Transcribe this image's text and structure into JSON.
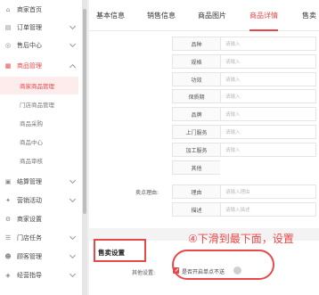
{
  "sidebar": {
    "items": [
      {
        "label": "商家首页",
        "icon": "home-icon"
      },
      {
        "label": "订单管理",
        "icon": "order-icon"
      },
      {
        "label": "售后中心",
        "icon": "aftersale-icon"
      },
      {
        "label": "商品管理",
        "icon": "product-icon"
      },
      {
        "label": "结算管理",
        "icon": "settlement-icon"
      },
      {
        "label": "营销活动",
        "icon": "marketing-icon"
      },
      {
        "label": "商家设置",
        "icon": "settings-icon"
      },
      {
        "label": "门店任务",
        "icon": "store-task-icon"
      },
      {
        "label": "顾客管理",
        "icon": "customer-icon"
      },
      {
        "label": "经营指导",
        "icon": "guide-icon"
      }
    ],
    "subitems": [
      {
        "label": "商家商品管理"
      },
      {
        "label": "门店商品管理"
      },
      {
        "label": "商品采购"
      },
      {
        "label": "商品中心"
      },
      {
        "label": "商品审核"
      }
    ]
  },
  "tabs": [
    {
      "label": "基本信息"
    },
    {
      "label": "销售信息"
    },
    {
      "label": "商品图片"
    },
    {
      "label": "商品详情"
    },
    {
      "label": "售卖"
    }
  ],
  "detail_rows": [
    {
      "label": "品种",
      "placeholder": "请输入"
    },
    {
      "label": "规格",
      "placeholder": "请输入"
    },
    {
      "label": "功效",
      "placeholder": "请输入"
    },
    {
      "label": "保质期",
      "placeholder": "请输入"
    },
    {
      "label": "品牌",
      "placeholder": "请输入"
    },
    {
      "label": "上门服务",
      "placeholder": "请输入"
    },
    {
      "label": "加工服务",
      "placeholder": "请输入"
    },
    {
      "label": "其他",
      "placeholder": ""
    }
  ],
  "buy_points": {
    "label": "卖点理由:",
    "rows": [
      {
        "label": "理由",
        "placeholder": "请输入理由"
      },
      {
        "label": "描述",
        "placeholder": "请输入描述"
      }
    ]
  },
  "sale_settings": {
    "title": "售卖设置",
    "row_label": "其他设置:",
    "checkbox_label": "是否开启单点不送",
    "checked": true
  },
  "annotation": {
    "text": "④下滑到最下面，设置",
    "color": "#e84848"
  },
  "colors": {
    "accent": "#e84848"
  }
}
